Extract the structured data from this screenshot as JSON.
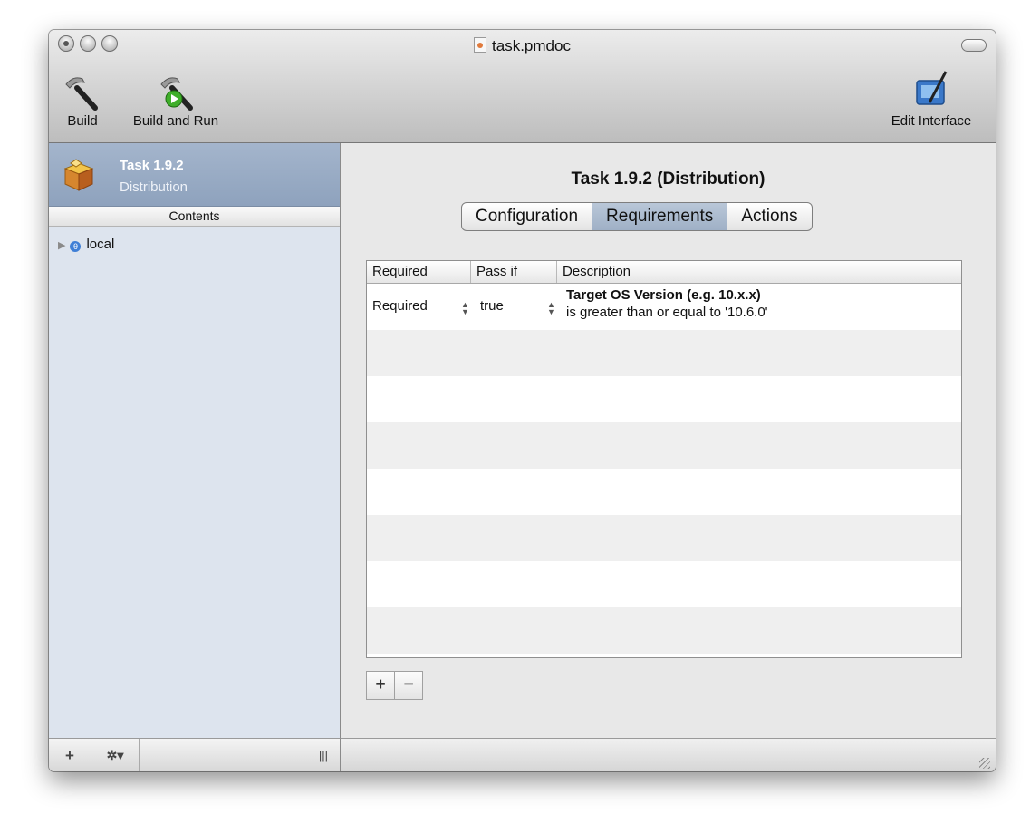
{
  "window": {
    "title": "task.pmdoc"
  },
  "toolbar": {
    "build_label": "Build",
    "build_run_label": "Build and Run",
    "edit_interface_label": "Edit Interface"
  },
  "sidebar": {
    "selected_title": "Task 1.9.2",
    "selected_subtitle": "Distribution",
    "contents_header": "Contents",
    "tree_items": [
      {
        "label": "local"
      }
    ],
    "bottom": {
      "add_label": "+",
      "action_label": "✲▾",
      "resize_label": "|||"
    }
  },
  "main": {
    "heading": "Task 1.9.2 (Distribution)",
    "tabs": [
      {
        "label": "Configuration",
        "active": false
      },
      {
        "label": "Requirements",
        "active": true
      },
      {
        "label": "Actions",
        "active": false
      }
    ],
    "table": {
      "columns": [
        "Required",
        "Pass if",
        "Description"
      ],
      "rows": [
        {
          "required": "Required",
          "pass_if": "true",
          "desc_title": "Target OS Version (e.g. 10.x.x)",
          "desc_detail": "is greater than or equal to '10.6.0'"
        }
      ]
    },
    "add_label": "+",
    "remove_label": "−"
  },
  "colors": {
    "selection": "#9aaec6",
    "sidebar_bg": "#dde4ee",
    "active_tab": "#abbacd"
  }
}
